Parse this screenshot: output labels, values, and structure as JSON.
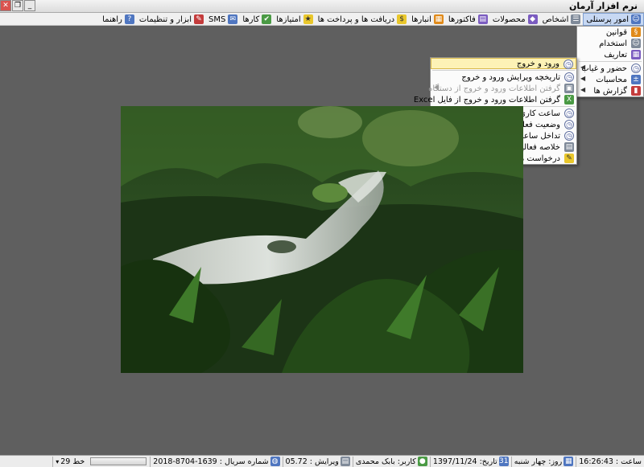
{
  "window": {
    "title": "نرم افزار آرمان",
    "close_glyph": "✕",
    "restore_glyph": "❐",
    "minimize_glyph": "_"
  },
  "menubar": {
    "items": [
      {
        "label": "امور پرسنلی",
        "icon": "people-icon",
        "active": true
      },
      {
        "label": "اشخاص",
        "icon": "contacts-icon"
      },
      {
        "label": "محصولات",
        "icon": "box-icon"
      },
      {
        "label": "فاکتورها",
        "icon": "invoice-icon"
      },
      {
        "label": "انبارها",
        "icon": "warehouse-icon"
      },
      {
        "label": "دریافت ها و پرداخت ها",
        "icon": "coins-icon"
      },
      {
        "label": "امتیازها",
        "icon": "star-icon"
      },
      {
        "label": "کارها",
        "icon": "tasks-icon"
      },
      {
        "label": "SMS",
        "icon": "sms-icon"
      },
      {
        "label": "ابزار و تنظیمات",
        "icon": "tools-icon"
      },
      {
        "label": "راهنما",
        "icon": "help-icon"
      }
    ]
  },
  "personnel_menu": {
    "items": [
      {
        "label": "قوانین",
        "icon": "rules-icon"
      },
      {
        "label": "استخدام",
        "icon": "hire-icon"
      },
      {
        "label": "تعاریف",
        "icon": "definitions-icon"
      },
      {
        "label": "حضور و غیاب",
        "icon": "attendance-icon",
        "submenu": true
      },
      {
        "label": "محاسبات",
        "icon": "calculator-icon",
        "submenu": true
      },
      {
        "label": "گزارش ها",
        "icon": "report-icon",
        "submenu": true
      }
    ]
  },
  "attendance_menu": {
    "items": [
      {
        "label": "ورود و خروج",
        "icon": "clock-icon"
      },
      {
        "label": "تاریخچه ویرایش ورود و خروج",
        "icon": "history-icon"
      },
      {
        "label": "گرفتن اطلاعات ورود و خروج از دستگاه",
        "icon": "device-icon",
        "disabled": true,
        "submenu": true
      },
      {
        "label": "گرفتن اطلاعات ورود و خروج از فایل Excel",
        "icon": "excel-icon"
      },
      {
        "label": "ساعت کاری کارمندان",
        "icon": "clock-icon"
      },
      {
        "label": "وضعیت فعلی ورود و خروج",
        "icon": "clock-icon"
      },
      {
        "label": "تداخل ساعات ورود و خروج",
        "icon": "clock-icon"
      },
      {
        "label": "خلاصه فعالیت روزانه",
        "icon": "summary-icon"
      },
      {
        "label": "درخواست های اضافه کاری، مرخصی و مأموریت",
        "icon": "request-icon"
      }
    ]
  },
  "statusbar": {
    "line": "خط 29",
    "serial": "شماره سریال : 1639-8704-2018",
    "version": "ویرایش : 05.72",
    "user": "کاربر: بابک محمدی",
    "date": "تاریخ: 1397/11/24",
    "day": "روز: چهار شنبه",
    "time": "ساعت : 16:26:43"
  }
}
